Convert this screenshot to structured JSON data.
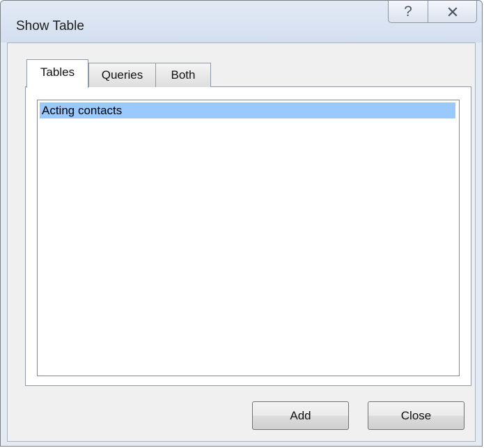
{
  "window": {
    "title": "Show Table",
    "help_glyph": "?"
  },
  "tabs": [
    {
      "label": "Tables",
      "active": true
    },
    {
      "label": "Queries",
      "active": false
    },
    {
      "label": "Both",
      "active": false
    }
  ],
  "list": {
    "items": [
      {
        "label": "Acting contacts",
        "selected": true
      }
    ],
    "selection_color": "#99c9ff"
  },
  "buttons": {
    "add_label": "Add",
    "close_label": "Close"
  },
  "icons": {
    "help": "help-icon",
    "close": "close-icon"
  }
}
